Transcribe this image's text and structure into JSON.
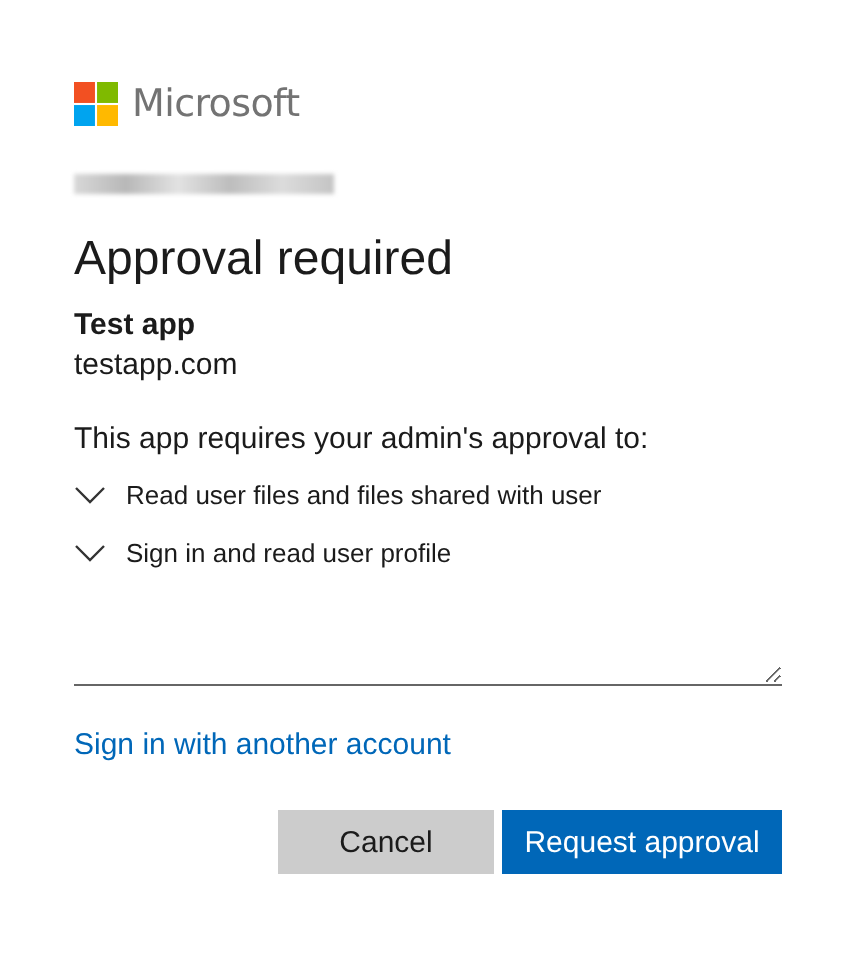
{
  "brand": {
    "name": "Microsoft"
  },
  "account": {
    "kind": "redacted"
  },
  "title": "Approval required",
  "app": {
    "name": "Test app",
    "domain": "testapp.com"
  },
  "prompt": "This app requires your admin's approval to:",
  "permissions": [
    {
      "label": "Read user files and files shared with user",
      "expanded": false
    },
    {
      "label": "Sign in and read user profile",
      "expanded": false
    }
  ],
  "justification": {
    "kind": "textarea"
  },
  "switch_account_link": "Sign in with another account",
  "buttons": [
    {
      "label": "Cancel",
      "kind": "secondary"
    },
    {
      "label": "Request approval",
      "kind": "primary"
    }
  ]
}
